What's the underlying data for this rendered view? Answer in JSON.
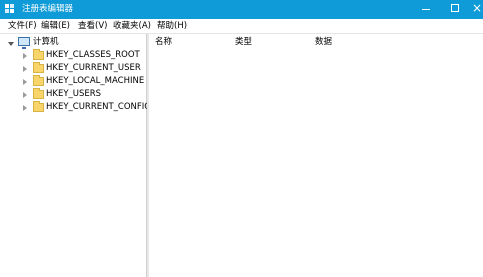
{
  "window": {
    "title": "注册表编辑器",
    "icon": "regedit-icon",
    "accent": "#0f9bd7",
    "controls": {
      "minimize_icon": "minimize-icon",
      "maximize_icon": "maximize-icon",
      "close_glyph": "×"
    }
  },
  "menu": [
    {
      "label": "文件(F)"
    },
    {
      "label": "编辑(E)"
    },
    {
      "label": "查看(V)"
    },
    {
      "label": "收藏夹(A)"
    },
    {
      "label": "帮助(H)"
    }
  ],
  "tree": {
    "root": {
      "label": "计算机",
      "icon": "computer-icon",
      "expanded": true
    },
    "children": [
      {
        "label": "HKEY_CLASSES_ROOT",
        "icon": "folder-icon"
      },
      {
        "label": "HKEY_CURRENT_USER",
        "icon": "folder-icon"
      },
      {
        "label": "HKEY_LOCAL_MACHINE",
        "icon": "folder-icon"
      },
      {
        "label": "HKEY_USERS",
        "icon": "folder-icon"
      },
      {
        "label": "HKEY_CURRENT_CONFIG",
        "icon": "folder-icon"
      }
    ]
  },
  "list": {
    "columns": [
      {
        "label": "名称"
      },
      {
        "label": "类型"
      },
      {
        "label": "数据"
      }
    ]
  }
}
